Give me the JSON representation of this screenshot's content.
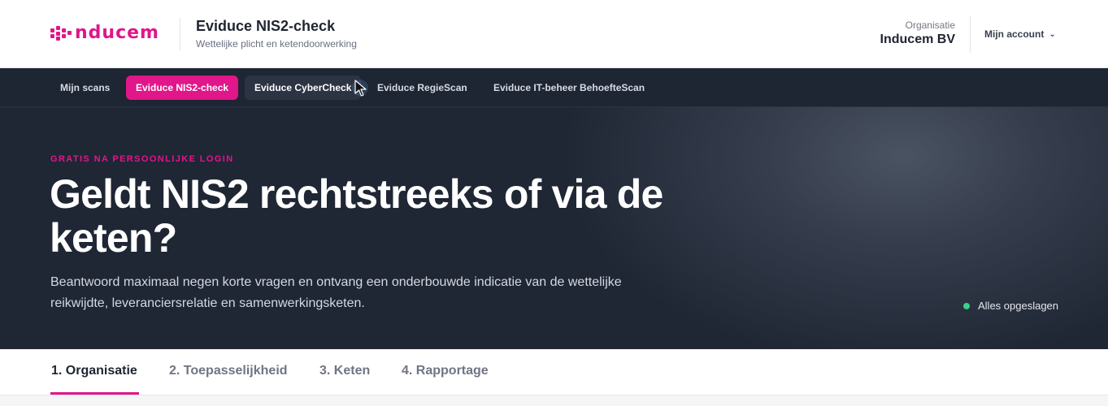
{
  "header": {
    "logo_text": "nducem",
    "app_title": "Eviduce NIS2-check",
    "app_subtitle": "Wettelijke plicht en ketendoorwerking",
    "org_label": "Organisatie",
    "org_name": "Inducem BV",
    "account_label": "Mijn account",
    "account_chevron": "⌄"
  },
  "nav": {
    "items": [
      {
        "label": "Mijn scans",
        "state": "default"
      },
      {
        "label": "Eviduce NIS2-check",
        "state": "active"
      },
      {
        "label": "Eviduce CyberCheck",
        "state": "hover"
      },
      {
        "label": "Eviduce RegieScan",
        "state": "default"
      },
      {
        "label": "Eviduce IT-beheer BehoefteScan",
        "state": "default"
      }
    ]
  },
  "hero": {
    "eyebrow": "GRATIS NA PERSOONLIJKE LOGIN",
    "title": "Geldt NIS2 rechtstreeks of via de keten?",
    "text": "Beantwoord maximaal negen korte vragen en ontvang een onderbouwde indicatie van de wettelijke reikwijdte, leveranciersrelatie en samenwerkingsketen.",
    "status": "Alles opgeslagen"
  },
  "steps": [
    {
      "label": "1. Organisatie",
      "active": true
    },
    {
      "label": "2. Toepasselijkheid",
      "active": false
    },
    {
      "label": "3. Keten",
      "active": false
    },
    {
      "label": "4. Rapportage",
      "active": false
    }
  ],
  "colors": {
    "brand": "#e0168a",
    "nav_bg": "#1e2533",
    "hero_bg": "#1f2634",
    "status_ok": "#3ccf8a"
  }
}
